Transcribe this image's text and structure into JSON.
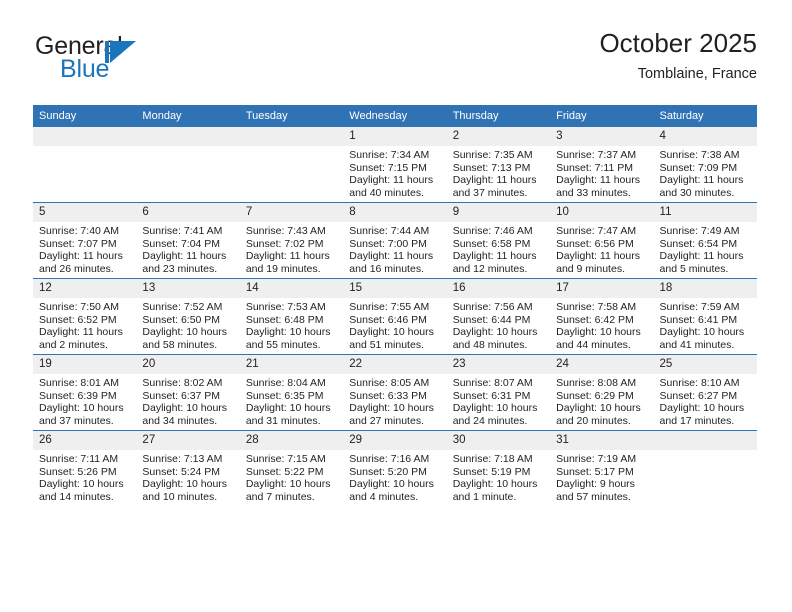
{
  "brand": {
    "name_top": "General",
    "name_bottom": "Blue",
    "logo_icon": "triangle-logo-icon",
    "accent_color": "#1b75bb"
  },
  "header": {
    "title": "October 2025",
    "subtitle": "Tomblaine, France"
  },
  "theme": {
    "header_blue": "#3073b4",
    "daynum_band": "#efefef",
    "text": "#231f20"
  },
  "calendar": {
    "weekday_headers": [
      "Sunday",
      "Monday",
      "Tuesday",
      "Wednesday",
      "Thursday",
      "Friday",
      "Saturday"
    ],
    "weeks": [
      [
        {
          "day": "",
          "empty": true
        },
        {
          "day": "",
          "empty": true
        },
        {
          "day": "",
          "empty": true
        },
        {
          "day": "1",
          "sunrise": "Sunrise: 7:34 AM",
          "sunset": "Sunset: 7:15 PM",
          "daylight1": "Daylight: 11 hours",
          "daylight2": "and 40 minutes."
        },
        {
          "day": "2",
          "sunrise": "Sunrise: 7:35 AM",
          "sunset": "Sunset: 7:13 PM",
          "daylight1": "Daylight: 11 hours",
          "daylight2": "and 37 minutes."
        },
        {
          "day": "3",
          "sunrise": "Sunrise: 7:37 AM",
          "sunset": "Sunset: 7:11 PM",
          "daylight1": "Daylight: 11 hours",
          "daylight2": "and 33 minutes."
        },
        {
          "day": "4",
          "sunrise": "Sunrise: 7:38 AM",
          "sunset": "Sunset: 7:09 PM",
          "daylight1": "Daylight: 11 hours",
          "daylight2": "and 30 minutes."
        }
      ],
      [
        {
          "day": "5",
          "sunrise": "Sunrise: 7:40 AM",
          "sunset": "Sunset: 7:07 PM",
          "daylight1": "Daylight: 11 hours",
          "daylight2": "and 26 minutes."
        },
        {
          "day": "6",
          "sunrise": "Sunrise: 7:41 AM",
          "sunset": "Sunset: 7:04 PM",
          "daylight1": "Daylight: 11 hours",
          "daylight2": "and 23 minutes."
        },
        {
          "day": "7",
          "sunrise": "Sunrise: 7:43 AM",
          "sunset": "Sunset: 7:02 PM",
          "daylight1": "Daylight: 11 hours",
          "daylight2": "and 19 minutes."
        },
        {
          "day": "8",
          "sunrise": "Sunrise: 7:44 AM",
          "sunset": "Sunset: 7:00 PM",
          "daylight1": "Daylight: 11 hours",
          "daylight2": "and 16 minutes."
        },
        {
          "day": "9",
          "sunrise": "Sunrise: 7:46 AM",
          "sunset": "Sunset: 6:58 PM",
          "daylight1": "Daylight: 11 hours",
          "daylight2": "and 12 minutes."
        },
        {
          "day": "10",
          "sunrise": "Sunrise: 7:47 AM",
          "sunset": "Sunset: 6:56 PM",
          "daylight1": "Daylight: 11 hours",
          "daylight2": "and 9 minutes."
        },
        {
          "day": "11",
          "sunrise": "Sunrise: 7:49 AM",
          "sunset": "Sunset: 6:54 PM",
          "daylight1": "Daylight: 11 hours",
          "daylight2": "and 5 minutes."
        }
      ],
      [
        {
          "day": "12",
          "sunrise": "Sunrise: 7:50 AM",
          "sunset": "Sunset: 6:52 PM",
          "daylight1": "Daylight: 11 hours",
          "daylight2": "and 2 minutes."
        },
        {
          "day": "13",
          "sunrise": "Sunrise: 7:52 AM",
          "sunset": "Sunset: 6:50 PM",
          "daylight1": "Daylight: 10 hours",
          "daylight2": "and 58 minutes."
        },
        {
          "day": "14",
          "sunrise": "Sunrise: 7:53 AM",
          "sunset": "Sunset: 6:48 PM",
          "daylight1": "Daylight: 10 hours",
          "daylight2": "and 55 minutes."
        },
        {
          "day": "15",
          "sunrise": "Sunrise: 7:55 AM",
          "sunset": "Sunset: 6:46 PM",
          "daylight1": "Daylight: 10 hours",
          "daylight2": "and 51 minutes."
        },
        {
          "day": "16",
          "sunrise": "Sunrise: 7:56 AM",
          "sunset": "Sunset: 6:44 PM",
          "daylight1": "Daylight: 10 hours",
          "daylight2": "and 48 minutes."
        },
        {
          "day": "17",
          "sunrise": "Sunrise: 7:58 AM",
          "sunset": "Sunset: 6:42 PM",
          "daylight1": "Daylight: 10 hours",
          "daylight2": "and 44 minutes."
        },
        {
          "day": "18",
          "sunrise": "Sunrise: 7:59 AM",
          "sunset": "Sunset: 6:41 PM",
          "daylight1": "Daylight: 10 hours",
          "daylight2": "and 41 minutes."
        }
      ],
      [
        {
          "day": "19",
          "sunrise": "Sunrise: 8:01 AM",
          "sunset": "Sunset: 6:39 PM",
          "daylight1": "Daylight: 10 hours",
          "daylight2": "and 37 minutes."
        },
        {
          "day": "20",
          "sunrise": "Sunrise: 8:02 AM",
          "sunset": "Sunset: 6:37 PM",
          "daylight1": "Daylight: 10 hours",
          "daylight2": "and 34 minutes."
        },
        {
          "day": "21",
          "sunrise": "Sunrise: 8:04 AM",
          "sunset": "Sunset: 6:35 PM",
          "daylight1": "Daylight: 10 hours",
          "daylight2": "and 31 minutes."
        },
        {
          "day": "22",
          "sunrise": "Sunrise: 8:05 AM",
          "sunset": "Sunset: 6:33 PM",
          "daylight1": "Daylight: 10 hours",
          "daylight2": "and 27 minutes."
        },
        {
          "day": "23",
          "sunrise": "Sunrise: 8:07 AM",
          "sunset": "Sunset: 6:31 PM",
          "daylight1": "Daylight: 10 hours",
          "daylight2": "and 24 minutes."
        },
        {
          "day": "24",
          "sunrise": "Sunrise: 8:08 AM",
          "sunset": "Sunset: 6:29 PM",
          "daylight1": "Daylight: 10 hours",
          "daylight2": "and 20 minutes."
        },
        {
          "day": "25",
          "sunrise": "Sunrise: 8:10 AM",
          "sunset": "Sunset: 6:27 PM",
          "daylight1": "Daylight: 10 hours",
          "daylight2": "and 17 minutes."
        }
      ],
      [
        {
          "day": "26",
          "sunrise": "Sunrise: 7:11 AM",
          "sunset": "Sunset: 5:26 PM",
          "daylight1": "Daylight: 10 hours",
          "daylight2": "and 14 minutes."
        },
        {
          "day": "27",
          "sunrise": "Sunrise: 7:13 AM",
          "sunset": "Sunset: 5:24 PM",
          "daylight1": "Daylight: 10 hours",
          "daylight2": "and 10 minutes."
        },
        {
          "day": "28",
          "sunrise": "Sunrise: 7:15 AM",
          "sunset": "Sunset: 5:22 PM",
          "daylight1": "Daylight: 10 hours",
          "daylight2": "and 7 minutes."
        },
        {
          "day": "29",
          "sunrise": "Sunrise: 7:16 AM",
          "sunset": "Sunset: 5:20 PM",
          "daylight1": "Daylight: 10 hours",
          "daylight2": "and 4 minutes."
        },
        {
          "day": "30",
          "sunrise": "Sunrise: 7:18 AM",
          "sunset": "Sunset: 5:19 PM",
          "daylight1": "Daylight: 10 hours",
          "daylight2": "and 1 minute."
        },
        {
          "day": "31",
          "sunrise": "Sunrise: 7:19 AM",
          "sunset": "Sunset: 5:17 PM",
          "daylight1": "Daylight: 9 hours",
          "daylight2": "and 57 minutes."
        },
        {
          "day": "",
          "empty": true
        }
      ]
    ]
  }
}
